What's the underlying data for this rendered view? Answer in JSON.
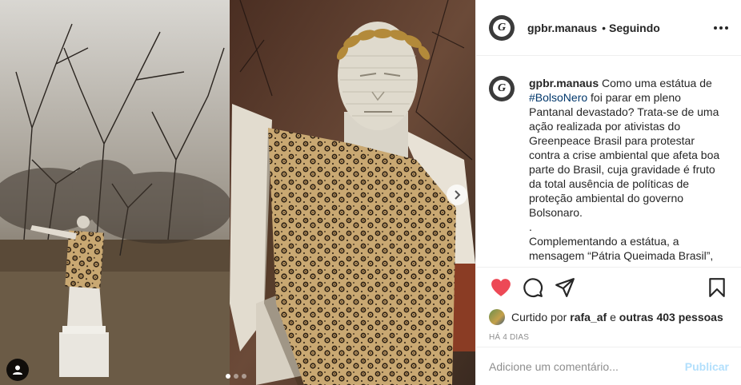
{
  "post": {
    "username": "gpbr.manaus",
    "separator": "•",
    "follow_status": "Seguindo",
    "avatar_letter": "G",
    "caption": {
      "username": "gpbr.manaus",
      "text_before_tag": " Como uma estátua de ",
      "hashtag": "#BolsoNero",
      "text_after_tag": " foi parar em pleno Pantanal devastado? Trata-se de uma ação realizada por ativistas do Greenpeace Brasil para protestar contra a crise ambiental que afeta boa parte do Brasil, cuja gravidade é fruto da total ausência de políticas de proteção ambiental do governo Bolsonaro.",
      "dot_line": ".",
      "continuation": "Complementando a estátua, a mensagem “Pátria Queimada Brasil”,"
    },
    "likes": {
      "prefix": "Curtido por ",
      "user": "rafa_af",
      "middle": " e ",
      "others": "outras 403 pessoas"
    },
    "time": "HÁ 4 DIAS",
    "comment": {
      "placeholder": "Adicione um comentário...",
      "post_label": "Publicar"
    },
    "carousel": {
      "slide_count": 3,
      "active_index": 0
    },
    "colors": {
      "like_red": "#ed4956",
      "hashtag_blue": "#00376b",
      "publish_disabled": "#b2dffc",
      "muted": "#8e8e8e"
    },
    "icons": [
      "heart-icon",
      "comment-icon",
      "share-icon",
      "bookmark-icon",
      "chevron-right-icon",
      "user-tag-icon",
      "more-icon"
    ]
  }
}
